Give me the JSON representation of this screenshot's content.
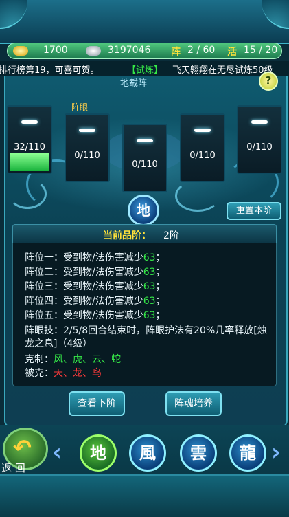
{
  "resources": {
    "gold": "1700",
    "silver": "3197046",
    "formation_label": "阵",
    "formation_value": "2 / 60",
    "active_label": "活",
    "active_value": "15 / 20"
  },
  "marquee": {
    "text_prefix": "排行榜第19，可喜可贺。",
    "tag": "【试炼】",
    "text_suffix": "飞天翱翔在无尽试炼50级"
  },
  "panel": {
    "title": "地载阵",
    "eye_label": "阵眼"
  },
  "cards": [
    {
      "value": "32/110",
      "progress": 0.29
    },
    {
      "value": "0/110",
      "progress": 0
    },
    {
      "value": "0/110",
      "progress": 0
    },
    {
      "value": "0/110",
      "progress": 0
    },
    {
      "value": "0/110",
      "progress": 0
    }
  ],
  "emblem": "地",
  "reset_button": "重置本阶",
  "info": {
    "grade_label": "当前品阶：",
    "grade_value": "2阶",
    "positions": [
      {
        "label": "阵位一：受到物/法伤害减少",
        "value": "63",
        "suffix": "；"
      },
      {
        "label": "阵位二：受到物/法伤害减少",
        "value": "63",
        "suffix": "；"
      },
      {
        "label": "阵位三：受到物/法伤害减少",
        "value": "63",
        "suffix": "；"
      },
      {
        "label": "阵位四：受到物/法伤害减少",
        "value": "63",
        "suffix": "；"
      },
      {
        "label": "阵位五：受到物/法伤害减少",
        "value": "63",
        "suffix": "；"
      }
    ],
    "eye_skill_line1": "阵眼技：2/5/8回合结束时，阵眼护法有20%几率释放[烛",
    "eye_skill_line2": "龙之息]（4级）",
    "counters_label": "克制：",
    "counters_value": "风、虎、云、蛇",
    "countered_label": "被克：",
    "countered_value": "天、龙、鸟"
  },
  "buttons": {
    "next": "查看下阶",
    "train": "阵魂培养"
  },
  "bottom": {
    "back": "返 回",
    "tokens": [
      "地",
      "風",
      "雲",
      "龍"
    ]
  },
  "colors": {
    "highlight_green": "#35e847",
    "warning_red": "#ff3a3a",
    "grade_yellow": "#ffe23a"
  }
}
